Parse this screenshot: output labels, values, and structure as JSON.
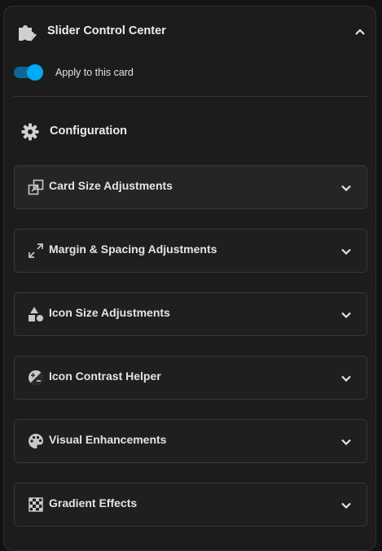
{
  "header": {
    "title": "Slider Control Center",
    "icon": "puzzle-check-icon",
    "collapse_icon": "chevron-up-icon"
  },
  "apply": {
    "label": "Apply to this card",
    "enabled": true
  },
  "configuration": {
    "label": "Configuration",
    "icon": "gear-icon"
  },
  "sections": [
    {
      "label": "Card Size Adjustments",
      "icon": "resize-icon",
      "expanded": false
    },
    {
      "label": "Margin & Spacing Adjustments",
      "icon": "arrow-expand-icon",
      "expanded": false
    },
    {
      "label": "Icon Size Adjustments",
      "icon": "shapes-icon",
      "expanded": false
    },
    {
      "label": "Icon Contrast Helper",
      "icon": "contrast-icon",
      "expanded": false
    },
    {
      "label": "Visual Enhancements",
      "icon": "palette-icon",
      "expanded": false
    },
    {
      "label": "Gradient Effects",
      "icon": "checkerboard-icon",
      "expanded": false
    }
  ],
  "colors": {
    "accent": "#03a9f4",
    "toggle_track": "#0d6796",
    "panel_bg": "#1c1c1c",
    "text": "#e4e4e4",
    "icon": "#c8c8c8"
  }
}
